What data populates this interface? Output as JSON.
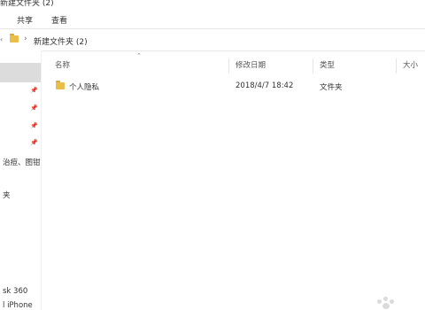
{
  "window": {
    "title": "新建文件夹 (2)"
  },
  "ribbon": {
    "tabs": [
      "共享",
      "查看"
    ]
  },
  "address": {
    "path": "新建文件夹 (2)"
  },
  "columns": {
    "name": "名称",
    "modified": "修改日期",
    "type": "类型",
    "size": "大小"
  },
  "files": [
    {
      "name": "个人隐私",
      "modified": "2018/4/7 18:42",
      "type": "文件夹",
      "size": ""
    }
  ],
  "navigation": {
    "items": [
      "治痘、图钳",
      "夹",
      "sk 360",
      "l iPhone"
    ]
  },
  "icons": {
    "back": "left-chevron-icon",
    "folder": "folder-icon",
    "breadcrumb_separator": "chevron-right-icon",
    "pin": "pin-icon",
    "sort": "sort-up-icon"
  },
  "colors": {
    "folder": "#e9bf49",
    "selected_nav": "#dcdcdc"
  }
}
